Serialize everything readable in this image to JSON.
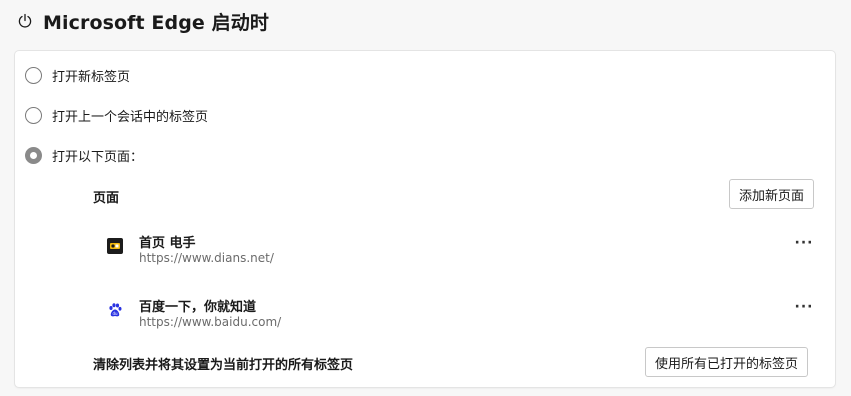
{
  "header": {
    "title": "Microsoft Edge 启动时",
    "icon": "power-icon"
  },
  "startup_options": [
    {
      "label": "打开新标签页",
      "selected": false
    },
    {
      "label": "打开上一个会话中的标签页",
      "selected": false
    },
    {
      "label": "打开以下页面：",
      "selected": true
    }
  ],
  "pages_section": {
    "label": "页面",
    "add_button": "添加新页面",
    "items": [
      {
        "title": "首页 电手",
        "url": "https://www.dians.net/",
        "icon": "dians-favicon-icon"
      },
      {
        "title": "百度一下，你就知道",
        "url": "https://www.baidu.com/",
        "icon": "baidu-paw-icon"
      }
    ],
    "more_label": "···"
  },
  "footer": {
    "label": "清除列表并将其设置为当前打开的所有标签页",
    "use_all_button": "使用所有已打开的标签页"
  },
  "colors": {
    "radio_checked": "#8a8a8a",
    "baidu_blue": "#2932e1",
    "url_gray": "#6b6b6b"
  }
}
